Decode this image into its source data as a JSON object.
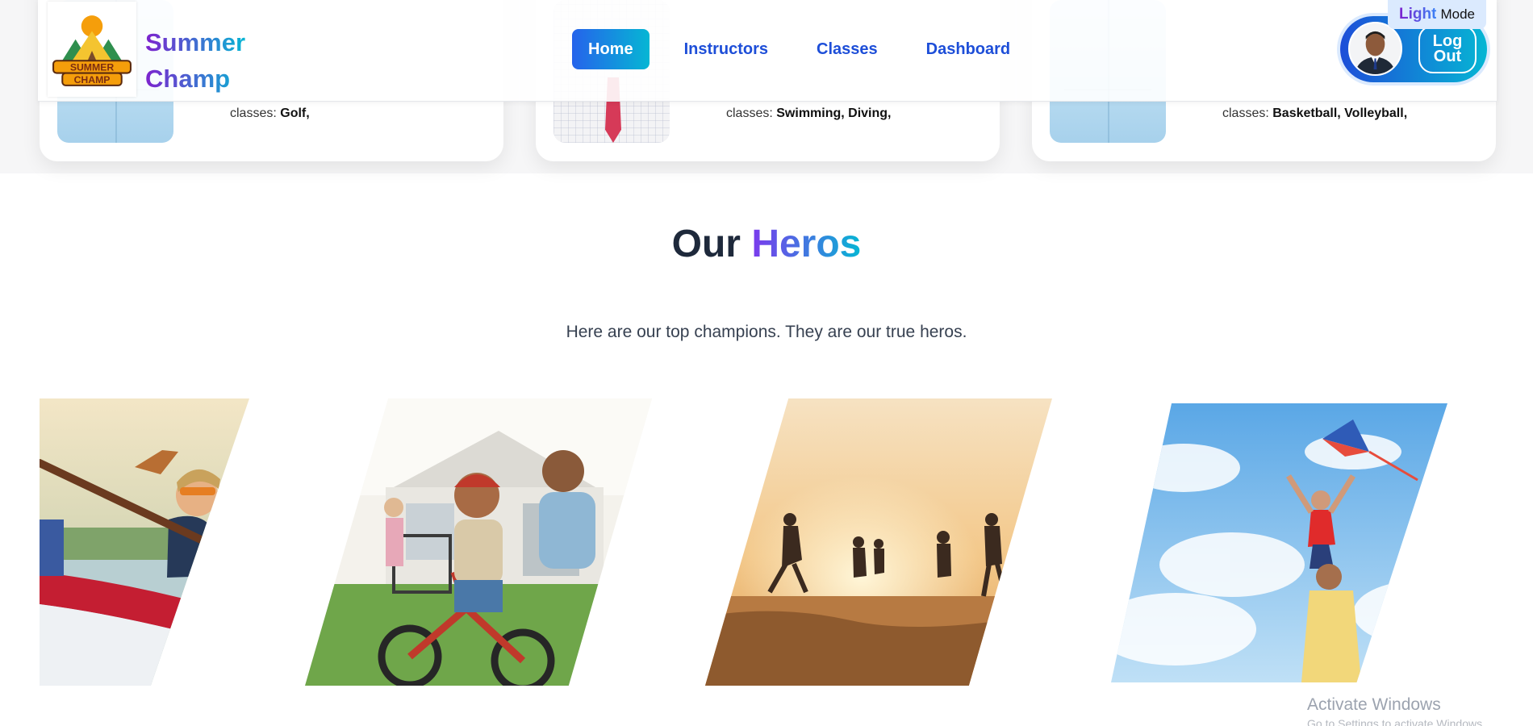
{
  "brand": {
    "line1": "Summer",
    "line2": "Champ",
    "logo_text_top": "SUMMER",
    "logo_text_bottom": "CHAMP"
  },
  "nav": {
    "items": [
      {
        "label": "Home",
        "active": true
      },
      {
        "label": "Instructors",
        "active": false
      },
      {
        "label": "Classes",
        "active": false
      },
      {
        "label": "Dashboard",
        "active": false
      }
    ]
  },
  "user": {
    "logout_line1": "Log",
    "logout_line2": "Out"
  },
  "mode_toggle": {
    "light": "Light",
    "mode": "Mode"
  },
  "instructors": [
    {
      "prefix": "classes:",
      "classes": "Golf,"
    },
    {
      "prefix": "classes:",
      "classes": "Swimming, Diving,"
    },
    {
      "prefix": "classes:",
      "classes": "Basketball, Volleyball,"
    }
  ],
  "heros_section": {
    "title_plain": "Our",
    "title_accent": "Heros",
    "subtitle": "Here are our top champions. They are our true heros."
  },
  "watermark": {
    "title": "Activate Windows",
    "subtitle": "Go to Settings to activate Windows."
  },
  "colors": {
    "accent_blue": "#1d4ed8",
    "accent_cyan": "#06b6d4",
    "accent_purple": "#7c3aed"
  }
}
